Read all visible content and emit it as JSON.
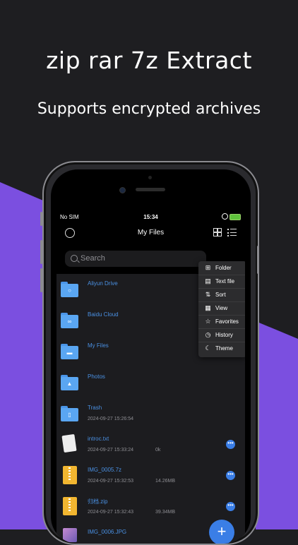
{
  "promo": {
    "headline": "zip rar 7z Extract",
    "subheadline": "Supports encrypted archives"
  },
  "status_bar": {
    "carrier": "No SIM",
    "time": "15:34"
  },
  "nav": {
    "title": "My Files"
  },
  "search": {
    "placeholder": "Search"
  },
  "files": [
    {
      "name": "Aliyun Drive",
      "date": "",
      "size": "",
      "icon": "cloud-folder-icon"
    },
    {
      "name": "Baidu Cloud",
      "date": "",
      "size": "",
      "icon": "cloud-folder-icon"
    },
    {
      "name": "My Files",
      "date": "",
      "size": "",
      "icon": "folder-icon"
    },
    {
      "name": "Photos",
      "date": "",
      "size": "",
      "icon": "photos-folder-icon"
    },
    {
      "name": "Trash",
      "date": "2024-09-27 15:26:54",
      "size": "",
      "icon": "trash-folder-icon"
    },
    {
      "name": "introc.txt",
      "date": "2024-09-27 15:33:24",
      "size": "0k",
      "icon": "text-file-icon"
    },
    {
      "name": "IMG_0005.7z",
      "date": "2024-09-27 15:32:53",
      "size": "14.26MB",
      "icon": "zip-file-icon"
    },
    {
      "name": "归档.zip",
      "date": "2024-09-27 15:32:43",
      "size": "39.34MB",
      "icon": "zip-file-icon"
    },
    {
      "name": "IMG_0006.JPG",
      "date": "",
      "size": "",
      "icon": "image-file-icon"
    }
  ],
  "menu": [
    {
      "label": "Folder",
      "icon": "new-folder-icon"
    },
    {
      "label": "Text file",
      "icon": "text-file-icon"
    },
    {
      "label": "Sort",
      "icon": "sort-icon"
    },
    {
      "label": "View",
      "icon": "grid-icon"
    },
    {
      "label": "Favorites",
      "icon": "star-icon"
    },
    {
      "label": "History",
      "icon": "history-icon"
    },
    {
      "label": "Theme",
      "icon": "moon-icon"
    }
  ],
  "colors": {
    "accent": "#3a7ee6",
    "purple": "#7b4fe0",
    "background": "#1e1e21"
  }
}
